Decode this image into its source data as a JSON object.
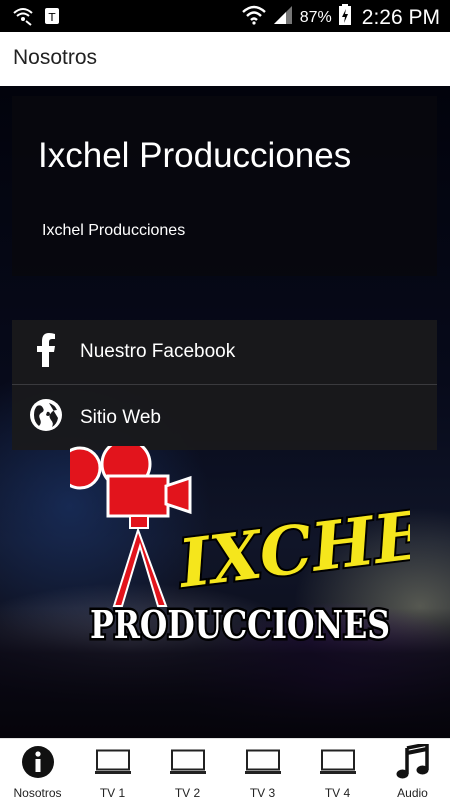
{
  "status_bar": {
    "battery_percent": "87%",
    "time": "2:26 PM",
    "icons": [
      "wifi-calling-icon",
      "t-mobile-icon",
      "wifi-icon",
      "signal-icon",
      "battery-charging-icon"
    ]
  },
  "app_bar": {
    "title": "Nosotros"
  },
  "intro": {
    "heading": "Ixchel Producciones",
    "subtitle": "Ixchel Producciones"
  },
  "links": [
    {
      "label": "Nuestro Facebook",
      "icon": "facebook-icon"
    },
    {
      "label": "Sitio Web",
      "icon": "globe-icon"
    }
  ],
  "logo": {
    "line1": "IXCHEL",
    "line2": "PRODUCCIONES"
  },
  "colors": {
    "logo_yellow": "#f5e61c",
    "logo_red": "#e2141c",
    "card_bg": "#08080e",
    "tab_active": "#111111"
  },
  "tabs": [
    {
      "label": "Nosotros",
      "icon": "info-icon",
      "active": true
    },
    {
      "label": "TV 1",
      "icon": "tv-icon",
      "active": false
    },
    {
      "label": "TV 2",
      "icon": "tv-icon",
      "active": false
    },
    {
      "label": "TV 3",
      "icon": "tv-icon",
      "active": false
    },
    {
      "label": "TV 4",
      "icon": "tv-icon",
      "active": false
    },
    {
      "label": "Audio",
      "icon": "music-note-icon",
      "active": false
    }
  ]
}
